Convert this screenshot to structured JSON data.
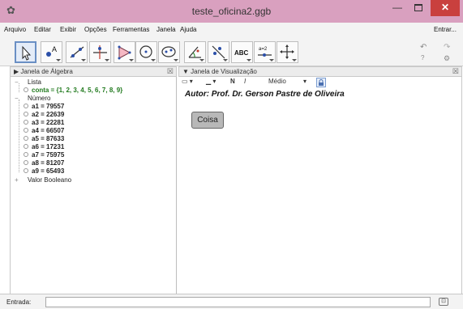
{
  "window": {
    "title": "teste_oficina2.ggb",
    "minimize_glyph": "—",
    "close_glyph": "✕",
    "app_icon_glyph": "✿",
    "title_bar_color": "#d9a0bf"
  },
  "menu": {
    "items": [
      "Arquivo",
      "Editar",
      "Exibir",
      "Opções",
      "Ferramentas",
      "Janela",
      "Ajuda"
    ],
    "sign_in": "Entrar..."
  },
  "toolbar": {
    "tools": [
      {
        "icon": "move-arrow-icon"
      },
      {
        "icon": "point-icon",
        "glyph": "A"
      },
      {
        "icon": "line-icon"
      },
      {
        "icon": "perpendicular-line-icon"
      },
      {
        "icon": "polygon-icon"
      },
      {
        "icon": "circle-icon"
      },
      {
        "icon": "ellipse-icon"
      },
      {
        "icon": "angle-icon"
      },
      {
        "icon": "reflect-icon"
      },
      {
        "icon": "text-icon",
        "glyph": "ABC"
      },
      {
        "icon": "slider-icon",
        "glyph": "a=2"
      },
      {
        "icon": "move-graphics-icon"
      }
    ],
    "undo_glyph": "↶",
    "redo_glyph": "↷",
    "help_glyph": "?",
    "settings_glyph": "⚙"
  },
  "algebra": {
    "header": "Janela de Álgebra",
    "collapse_glyph": "▶",
    "close_glyph": "☒",
    "groups": {
      "lista": {
        "label": "Lista",
        "toggle": "−",
        "items": [
          "conta = {1, 2, 3, 4, 5, 6, 7, 8, 9}"
        ]
      },
      "numero": {
        "label": "Número",
        "toggle": "−",
        "items": [
          "a1 = 79557",
          "a2 = 22639",
          "a3 = 22281",
          "a4 = 66507",
          "a5 = 87633",
          "a6 = 17231",
          "a7 = 75975",
          "a8 = 81207",
          "a9 = 65493"
        ]
      },
      "booleano": {
        "label": "Valor Booleano",
        "toggle": "+"
      }
    }
  },
  "graphics": {
    "header": "Janela de Visualização",
    "collapse_glyph": "▼",
    "close_glyph": "☒",
    "style_bar": {
      "color_glyph": "▭ ▾",
      "line_glyph": "▁ ▾",
      "bold": "N",
      "italic": "I",
      "size": "Médio",
      "size_arrow": "▾",
      "lock_glyph": "🔒"
    },
    "author_text": "Autor: Prof. Dr. Gerson Pastre de Oliveira",
    "button_label": "Coisa"
  },
  "input_bar": {
    "label": "Entrada:",
    "value": "",
    "keyboard_glyph": "⊡"
  }
}
